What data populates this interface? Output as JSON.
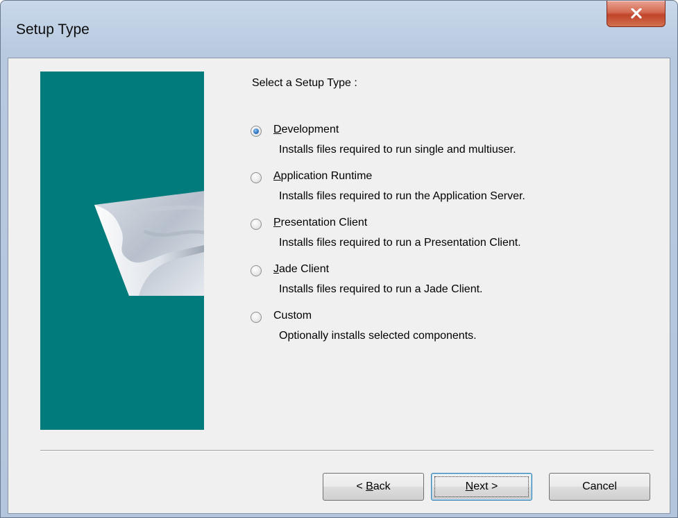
{
  "window": {
    "title": "Setup Type"
  },
  "main": {
    "heading": "Select a Setup Type :",
    "options": [
      {
        "label_mnemonic": "D",
        "label_rest": "evelopment",
        "description": "Installs files required to run single and multiuser.",
        "selected": true
      },
      {
        "label_mnemonic": "A",
        "label_rest": "pplication Runtime",
        "description": "Installs files required to run the Application Server.",
        "selected": false
      },
      {
        "label_mnemonic": "P",
        "label_rest": "resentation Client",
        "description": "Installs files required to run a Presentation Client.",
        "selected": false
      },
      {
        "label_mnemonic": "J",
        "label_rest": "ade Client",
        "description": "Installs files required to run a Jade Client.",
        "selected": false
      },
      {
        "label_mnemonic": "",
        "label_rest": "Custom",
        "description": "Optionally installs selected components.",
        "selected": false
      }
    ]
  },
  "buttons": {
    "back_prefix": "< ",
    "back_mnemonic": "B",
    "back_rest": "ack",
    "next_mnemonic": "N",
    "next_rest": "ext >",
    "cancel": "Cancel"
  },
  "colors": {
    "side_panel": "#017b7b",
    "client_bg": "#f0f0f0",
    "close_button": "#c0442a"
  },
  "icons": {
    "close": "close-x-icon",
    "side_graphic": "folded-page-graphic"
  }
}
